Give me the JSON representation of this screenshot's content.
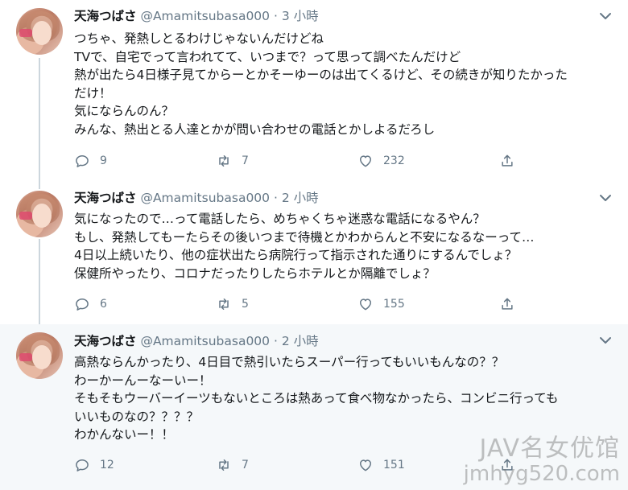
{
  "tweets": [
    {
      "name": "天海つばさ",
      "handle": "@Amamitsubasa000",
      "dot": "·",
      "time": "3 小時",
      "lines": [
        "つちゃ、発熱しとるわけじゃないんだけどね",
        "TVで、自宅でって言われてて、いつまで？って思って調べたんだけど",
        "熱が出たら4日様子見てからーとかそーゆーのは出てくるけど、その続きが知りたかった",
        "だけ！",
        "気にならんのん？",
        "みんな、熱出とる人達とかが問い合わせの電話とかしよるだろし"
      ],
      "replies": "9",
      "retweets": "7",
      "likes": "232"
    },
    {
      "name": "天海つばさ",
      "handle": "@Amamitsubasa000",
      "dot": "·",
      "time": "2 小時",
      "lines": [
        "気になったので…って電話したら、めちゃくちゃ迷惑な電話になるやん？",
        "もし、発熱してもーたらその後いつまで待機とかわからんと不安になるなーって…",
        "4日以上続いたり、他の症状出たら病院行って指示された通りにするんでしょ？",
        "保健所やったり、コロナだったりしたらホテルとか隔離でしょ？"
      ],
      "replies": "6",
      "retweets": "5",
      "likes": "155"
    },
    {
      "name": "天海つばさ",
      "handle": "@Amamitsubasa000",
      "dot": "·",
      "time": "2 小時",
      "lines": [
        "高熱ならんかったり、4日目で熱引いたらスーパー行ってもいいもんなの？？",
        "わーかーんーなーいー！",
        "そもそもウーバーイーツもないところは熱あって食べ物なかったら、コンビニ行っても",
        "いいものなの？？？？",
        "わかんないー！！"
      ],
      "replies": "12",
      "retweets": "7",
      "likes": "151"
    }
  ],
  "icons": {
    "more": "chevron-down-icon",
    "reply": "reply-icon",
    "retweet": "retweet-icon",
    "like": "heart-icon",
    "share": "share-icon"
  },
  "watermark": {
    "line1": "JAV名女优馆",
    "line2": "jmhyg520.com"
  }
}
